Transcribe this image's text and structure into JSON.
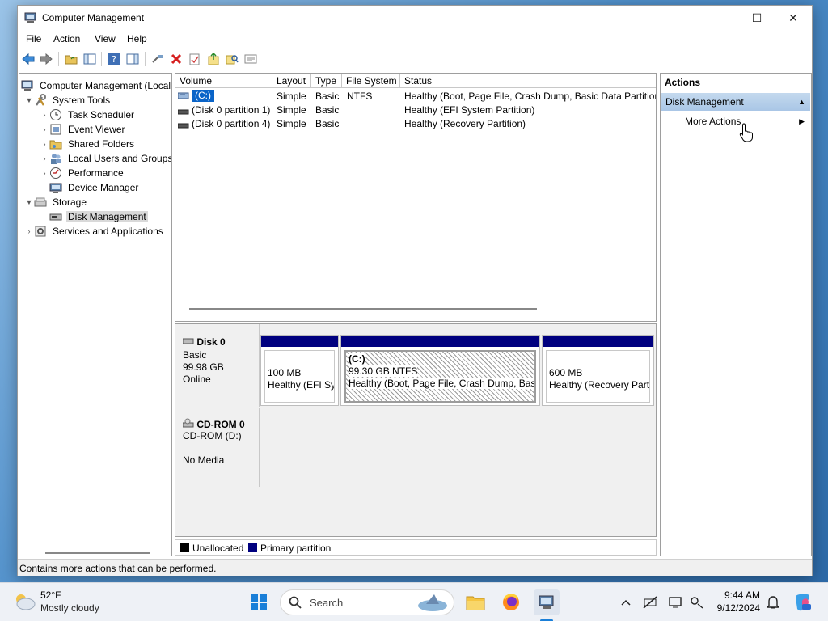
{
  "window": {
    "title": "Computer Management",
    "controls": {
      "minimize": "—",
      "maximize": "☐",
      "close": "✕"
    }
  },
  "menu": [
    "File",
    "Action",
    "View",
    "Help"
  ],
  "tree": {
    "root": "Computer Management (Local",
    "system_tools": "System Tools",
    "task_scheduler": "Task Scheduler",
    "event_viewer": "Event Viewer",
    "shared_folders": "Shared Folders",
    "local_users": "Local Users and Groups",
    "performance": "Performance",
    "device_manager": "Device Manager",
    "storage": "Storage",
    "disk_management": "Disk Management",
    "services": "Services and Applications"
  },
  "volumes": {
    "columns": [
      "Volume",
      "Layout",
      "Type",
      "File System",
      "Status"
    ],
    "rows": [
      {
        "volume": "(C:)",
        "layout": "Simple",
        "type": "Basic",
        "fs": "NTFS",
        "status": "Healthy (Boot, Page File, Crash Dump, Basic Data Partition)"
      },
      {
        "volume": "(Disk 0 partition 1)",
        "layout": "Simple",
        "type": "Basic",
        "fs": "",
        "status": "Healthy (EFI System Partition)"
      },
      {
        "volume": "(Disk 0 partition 4)",
        "layout": "Simple",
        "type": "Basic",
        "fs": "",
        "status": "Healthy (Recovery Partition)"
      }
    ]
  },
  "disk0": {
    "name": "Disk 0",
    "type": "Basic",
    "size": "99.98 GB",
    "state": "Online",
    "partitions": [
      {
        "title": "",
        "size": "100 MB",
        "status": "Healthy (EFI Sys"
      },
      {
        "title": "(C:)",
        "size": "99.30 GB NTFS",
        "status": "Healthy (Boot, Page File, Crash Dump, Basic"
      },
      {
        "title": "",
        "size": "600 MB",
        "status": "Healthy (Recovery Partit"
      }
    ]
  },
  "cdrom": {
    "name": "CD-ROM 0",
    "drive": "CD-ROM (D:)",
    "media": "No Media"
  },
  "legend": {
    "unallocated": "Unallocated",
    "primary": "Primary partition",
    "unallocated_color": "#000000",
    "primary_color": "#00007f"
  },
  "actions": {
    "header": "Actions",
    "group": "Disk Management",
    "more": "More Actions"
  },
  "status_text": "Contains more actions that can be performed.",
  "taskbar": {
    "temp": "52°F",
    "weather": "Mostly cloudy",
    "search": "Search",
    "time": "9:44 AM",
    "date": "9/12/2024"
  }
}
